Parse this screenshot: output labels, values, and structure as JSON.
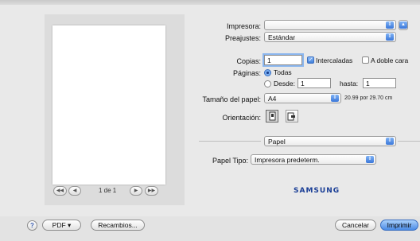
{
  "preview": {
    "first_label": "◀◀",
    "prev_label": "◀",
    "page_text": "1 de 1",
    "next_label": "▶",
    "last_label": "▶▶"
  },
  "form": {
    "printer_label": "Impresora:",
    "printer_value": "",
    "presets_label": "Preajustes:",
    "presets_value": "Estándar",
    "copies_label": "Copias:",
    "copies_value": "1",
    "collated_label": "Intercaladas",
    "two_sided_label": "A doble cara",
    "pages_label": "Páginas:",
    "pages_all_label": "Todas",
    "pages_from_label": "Desde:",
    "pages_from_value": "1",
    "pages_to_label": "hasta:",
    "pages_to_value": "1",
    "paper_size_label": "Tamaño del papel:",
    "paper_size_value": "A4",
    "paper_size_dims": "20.99 por 29.70 cm",
    "orientation_label": "Orientación:",
    "section_value": "Papel",
    "paper_type_label": "Papel Tipo:",
    "paper_type_value": "Impresora predeterm."
  },
  "brand": "SAMSUNG",
  "bottom": {
    "help_label": "?",
    "pdf_label": "PDF ▾",
    "supplies_label": "Recambios...",
    "cancel_label": "Cancelar",
    "print_label": "Imprimir"
  },
  "icons": {
    "select_arrows": "select-arrows-icon",
    "portrait": "portrait-orientation-icon",
    "landscape": "landscape-orientation-icon"
  },
  "colors": {
    "accent": "#4a8be6",
    "brand": "#1a3e96"
  }
}
